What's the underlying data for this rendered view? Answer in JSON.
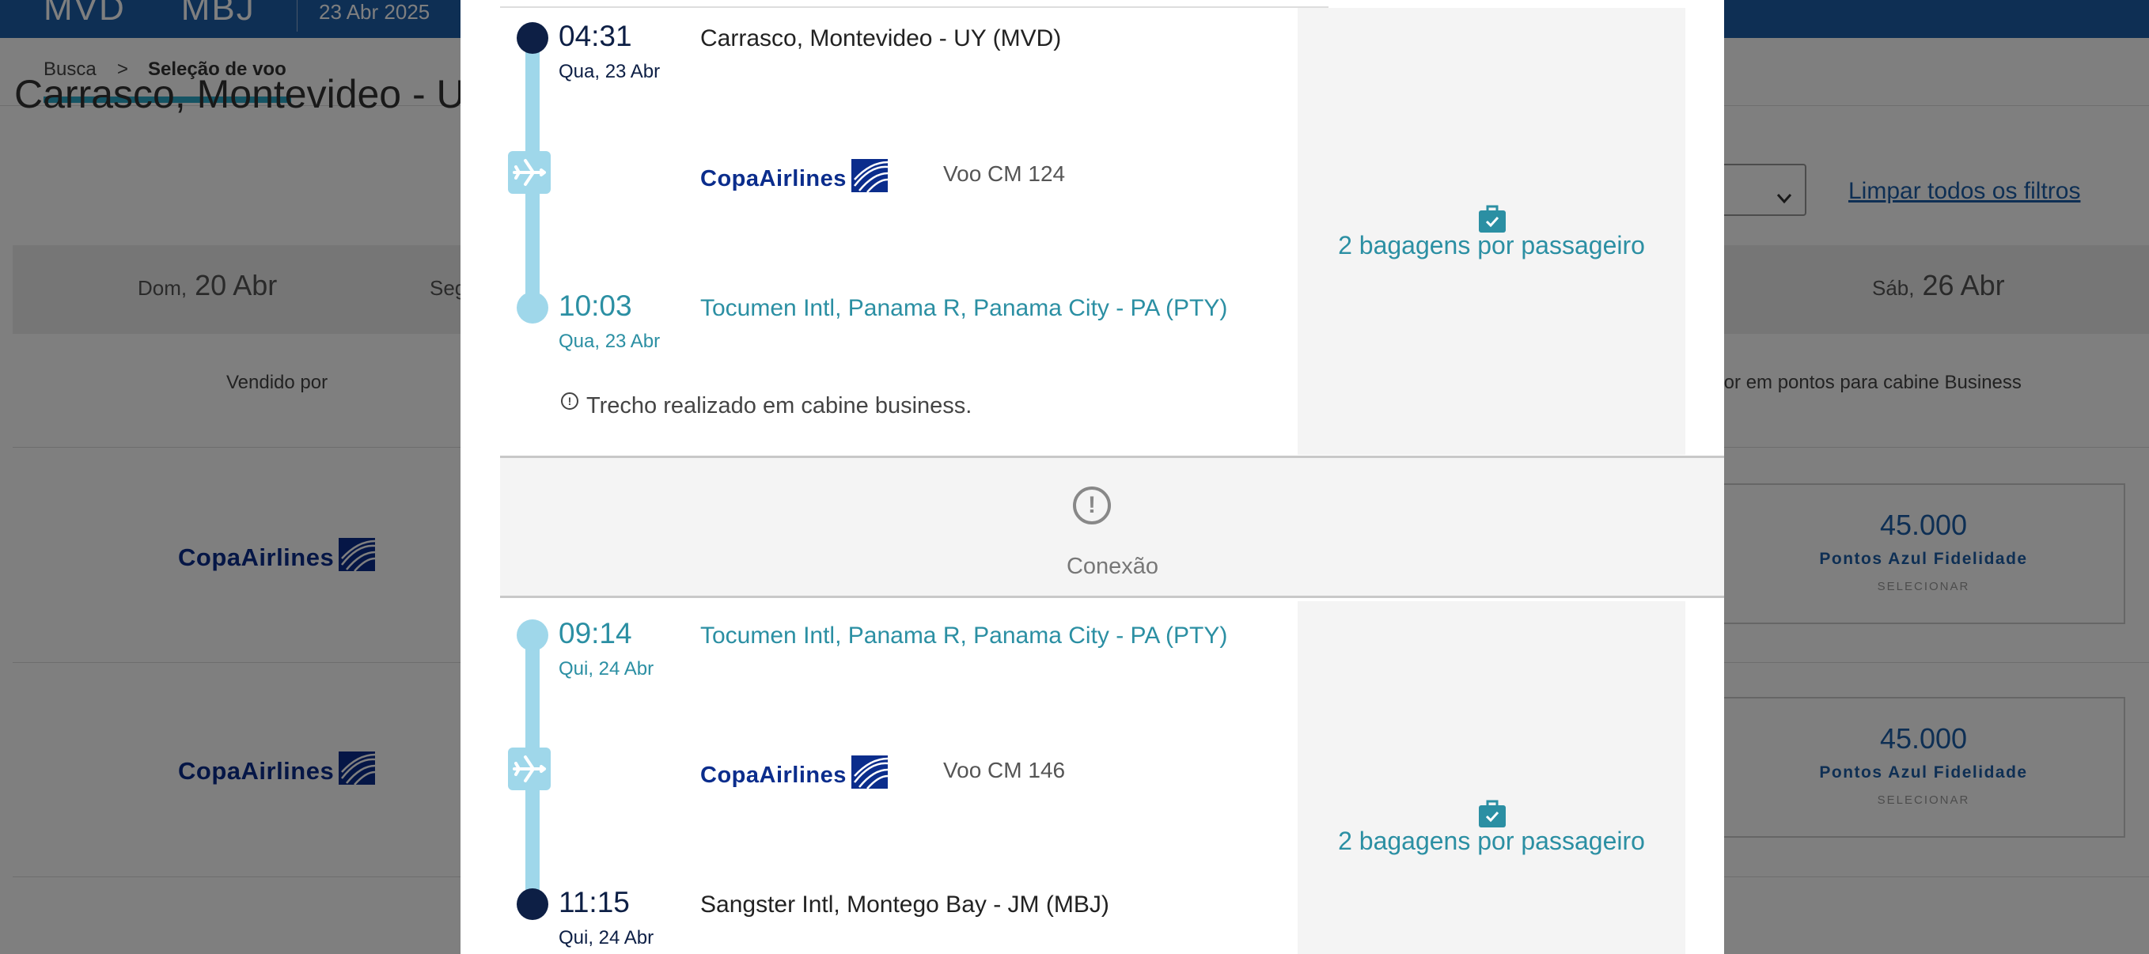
{
  "header": {
    "origin_code": "MVD",
    "destination_code": "MBJ",
    "date": "23 Abr 2025"
  },
  "breadcrumb": {
    "step1": "Busca",
    "separator": ">",
    "step2": "Seleção de voo"
  },
  "background": {
    "route_title": "Carrasco, Montevideo - U",
    "clear_filters": "Limpar todos os filtros",
    "dates": [
      {
        "weekday": "Dom,",
        "day": "20 Abr"
      },
      {
        "weekday": "Seg",
        "day": ""
      },
      {
        "weekday": "Sáb,",
        "day": "26 Abr"
      }
    ],
    "sold_by_header": "Vendido por",
    "points_header": "alor em pontos para cabine Business",
    "rows": [
      {
        "airline": "CopaAirlines",
        "points": "45.000",
        "points_label": "Pontos Azul Fidelidade",
        "select_label": "SELECIONAR"
      },
      {
        "airline": "CopaAirlines",
        "points": "45.000",
        "points_label": "Pontos Azul Fidelidade",
        "select_label": "SELECIONAR"
      }
    ]
  },
  "modal": {
    "segment1": {
      "departure_time": "04:31",
      "departure_day": "Qua, 23 Abr",
      "departure_airport": "Carrasco, Montevideo - UY (MVD)",
      "airline": "CopaAirlines",
      "flight": "Voo CM 124",
      "arrival_time": "10:03",
      "arrival_day": "Qua, 23 Abr",
      "arrival_airport": "Tocumen Intl, Panama R, Panama City - PA (PTY)",
      "baggage": "2 bagagens por passageiro",
      "note": "Trecho realizado em cabine business."
    },
    "connection_label": "Conexão",
    "segment2": {
      "departure_time": "09:14",
      "departure_day": "Qui, 24 Abr",
      "departure_airport": "Tocumen Intl, Panama R, Panama City - PA (PTY)",
      "airline": "CopaAirlines",
      "flight": "Voo CM 146",
      "arrival_time": "11:15",
      "arrival_day": "Qui, 24 Abr",
      "arrival_airport": "Sangster Intl, Montego Bay - JM (MBJ)",
      "baggage": "2 bagagens por passageiro"
    }
  },
  "colors": {
    "brand_blue": "#1d5fa8",
    "teal": "#2b8fa3",
    "timeline": "#9fd7ea",
    "dark_navy": "#0d1f45",
    "copa_blue": "#0b2d8c"
  }
}
